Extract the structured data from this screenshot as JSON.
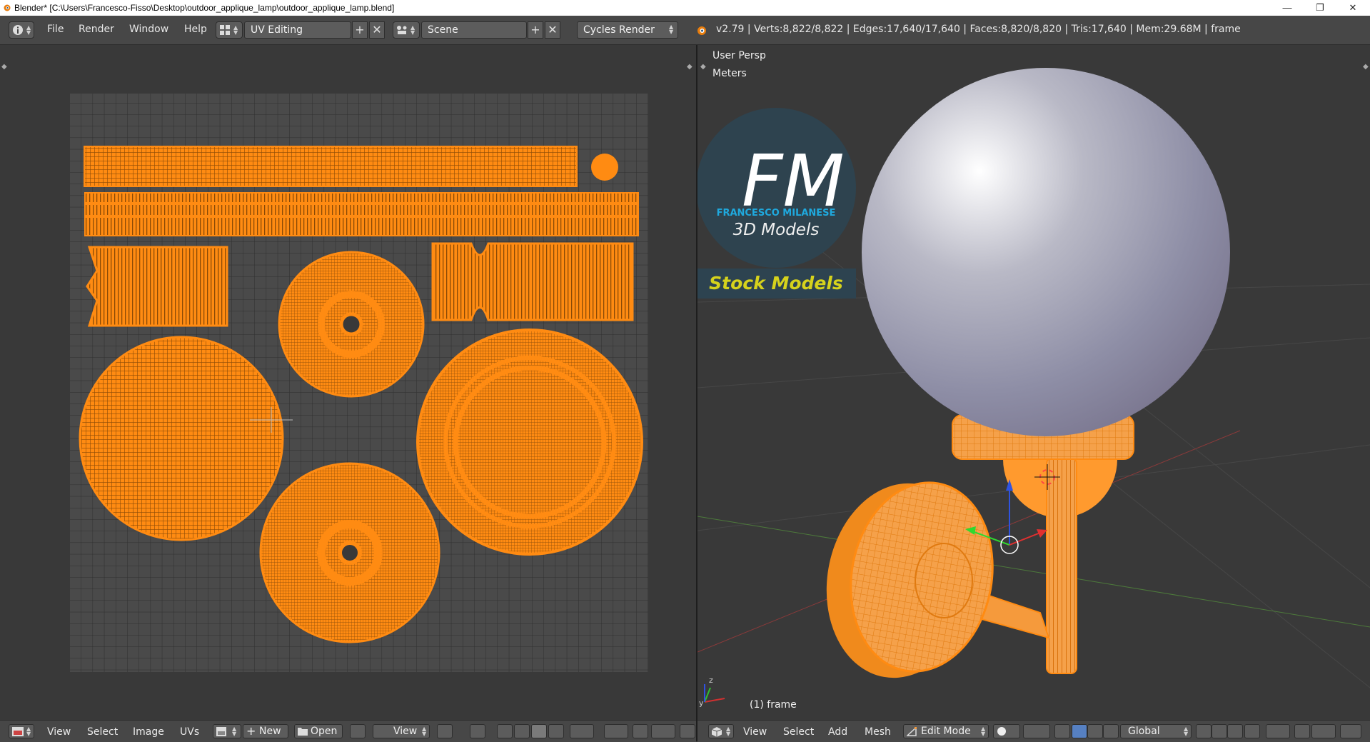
{
  "window": {
    "title": "Blender* [C:\\Users\\Francesco-Fisso\\Desktop\\outdoor_applique_lamp\\outdoor_applique_lamp.blend]",
    "icon": "blender-icon",
    "controls": [
      "minimize-icon",
      "restore-icon",
      "close-icon"
    ]
  },
  "info_header": {
    "menus": [
      "File",
      "Render",
      "Window",
      "Help"
    ],
    "screen_layout": "UV Editing",
    "scene": "Scene",
    "render_engine": "Cycles Render",
    "stats": "v2.79 | Verts:8,822/8,822 | Edges:17,640/17,640 | Faces:8,820/8,820 | Tris:17,640 | Mem:29.68M | frame"
  },
  "uv_editor": {
    "header_menus": [
      "View",
      "Select",
      "Image",
      "UVs"
    ],
    "new_label": "New",
    "open_label": "Open",
    "view_label": "View"
  },
  "viewport": {
    "view_name": "User Persp",
    "units": "Meters",
    "frame_label": "(1) frame",
    "header_menus": [
      "View",
      "Select",
      "Add",
      "Mesh"
    ],
    "mode": "Edit Mode",
    "orientation": "Global"
  },
  "logo": {
    "letters": "FM",
    "author": "FRANCESCO MILANESE",
    "subtitle": "3D Models",
    "banner": "Stock Models"
  },
  "colors": {
    "uv_orange": "#ff8b12",
    "panel_bg": "#393939",
    "header_bg": "#474747",
    "logo_blue": "#1fa9de",
    "banner_yellow": "#d6d21c"
  }
}
